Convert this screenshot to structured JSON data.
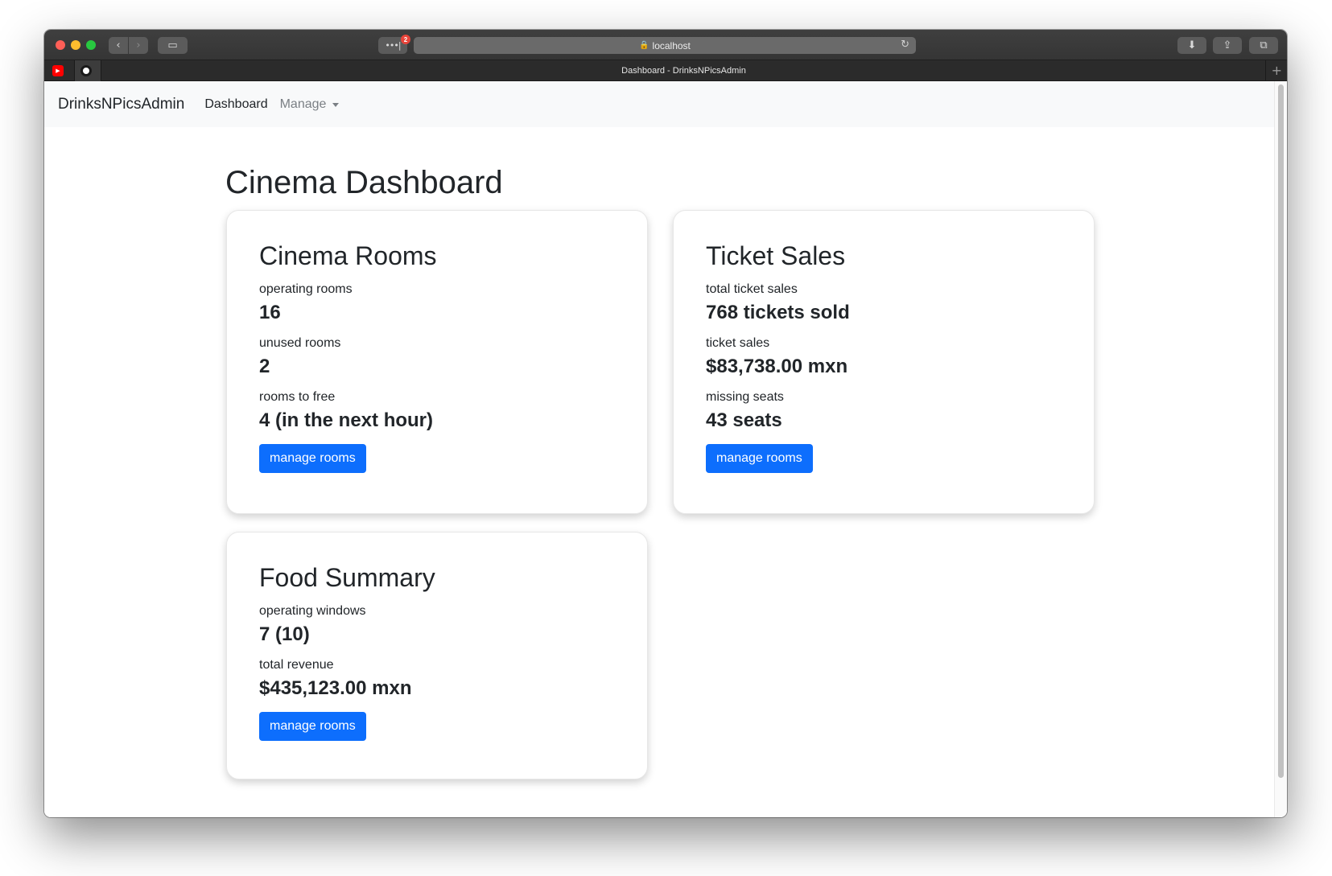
{
  "browser": {
    "address": "localhost",
    "tab_title": "Dashboard - DrinksNPicsAdmin",
    "extension_badge": "2"
  },
  "navbar": {
    "brand": "DrinksNPicsAdmin",
    "links": [
      "Dashboard",
      "Manage"
    ]
  },
  "page": {
    "title": "Cinema Dashboard"
  },
  "cards": {
    "rooms": {
      "title": "Cinema Rooms",
      "stats": [
        {
          "label": "operating rooms",
          "value": "16"
        },
        {
          "label": "unused rooms",
          "value": "2"
        },
        {
          "label": "rooms to free",
          "value": "4 (in the next hour)"
        }
      ],
      "button": "manage rooms"
    },
    "tickets": {
      "title": "Ticket Sales",
      "stats": [
        {
          "label": "total ticket sales",
          "value": "768 tickets sold"
        },
        {
          "label": "ticket sales",
          "value": "$83,738.00 mxn"
        },
        {
          "label": "missing seats",
          "value": "43 seats"
        }
      ],
      "button": "manage rooms"
    },
    "food": {
      "title": "Food Summary",
      "stats": [
        {
          "label": "operating windows",
          "value": "7 (10)"
        },
        {
          "label": "total revenue",
          "value": "$435,123.00 mxn"
        }
      ],
      "button": "manage rooms"
    }
  },
  "colors": {
    "primary": "#0d6efd",
    "navbar_bg": "#f8f9fa",
    "text": "#212529"
  }
}
